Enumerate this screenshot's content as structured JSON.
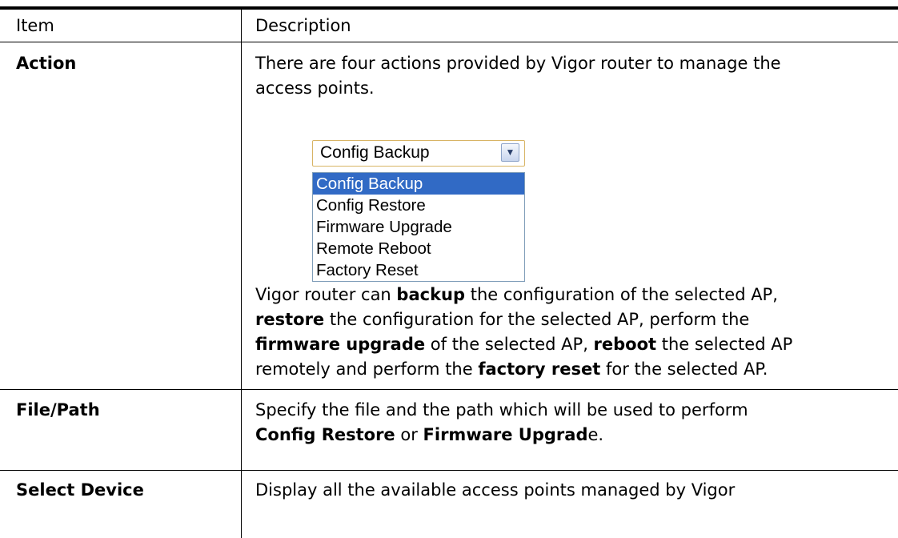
{
  "table": {
    "headers": {
      "item": "Item",
      "description": "Description"
    },
    "rows": [
      {
        "item": "Action",
        "intro_line1": "There are four actions provided by Vigor router to manage the",
        "intro_line2": "access points.",
        "dropdown": {
          "selected": "Config Backup",
          "options": [
            "Config Backup",
            "Config Restore",
            "Firmware Upgrade",
            "Remote Reboot",
            "Factory Reset"
          ],
          "highlighted_index": 0
        },
        "detail": {
          "l1_a": "Vigor router can ",
          "l1_b": "backup",
          "l1_c": " the configuration of the selected AP,",
          "l2_a": "restore",
          "l2_b": " the configuration for the selected AP, perform the",
          "l3_a": "firmware upgrade",
          "l3_b": " of the selected AP, ",
          "l3_c": "reboot",
          "l3_d": " the selected AP",
          "l4_a": "remotely and perform the ",
          "l4_b": "factory reset",
          "l4_c": " for the selected AP."
        }
      },
      {
        "item": "File/Path",
        "l1": "Specify the file and the path which will be used to perform",
        "l2_a": "Config Restore",
        "l2_b": " or ",
        "l2_c": "Firmware Upgrad",
        "l2_d": "e."
      },
      {
        "item": "Select Device",
        "l1": "Display all the available access points managed by Vigor"
      }
    ]
  }
}
